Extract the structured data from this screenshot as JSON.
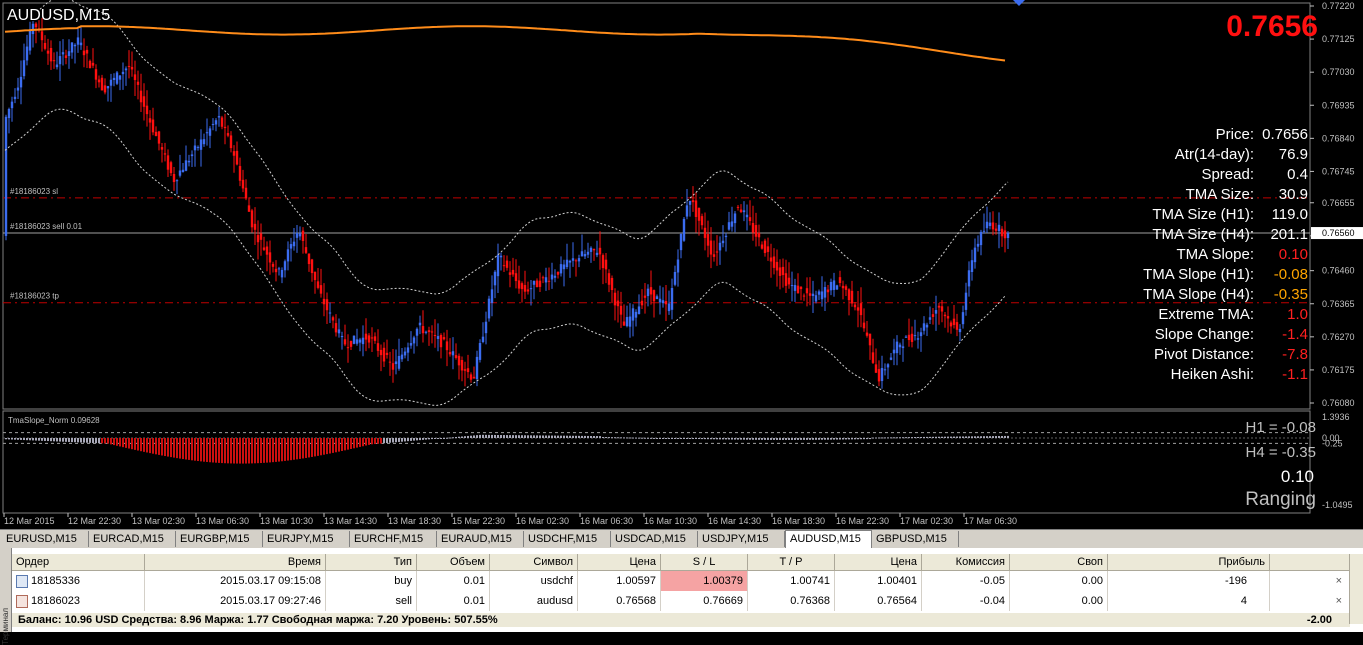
{
  "chart": {
    "symbol_title": "AUDUSD,M15",
    "window_tag": "AUDUSD,M15",
    "big_price": "0.7656",
    "price_scale": [
      "0.77220",
      "0.77125",
      "0.77030",
      "0.76935",
      "0.76840",
      "0.76745",
      "0.76655",
      "0.76560",
      "0.76460",
      "0.76365",
      "0.76270",
      "0.76175",
      "0.76080"
    ],
    "current_price_tag": "0.76560",
    "line_labels": {
      "sl": "#18186023 sl",
      "sell": "#18186023 sell 0.01",
      "tp": "#18186023 tp"
    },
    "info_panel": [
      {
        "label": "Price:",
        "value": "0.7656",
        "color": "#ffffff"
      },
      {
        "label": "Atr(14-day):",
        "value": "76.9",
        "color": "#ffffff"
      },
      {
        "label": "Spread:",
        "value": "0.4",
        "color": "#ffffff"
      },
      {
        "label": "TMA Size:",
        "value": "30.9",
        "color": "#ffffff"
      },
      {
        "label": "TMA Size (H1):",
        "value": "119.0",
        "color": "#ffffff"
      },
      {
        "label": "TMA Size (H4):",
        "value": "201.1",
        "color": "#ffffff"
      },
      {
        "label": "TMA Slope:",
        "value": "0.10",
        "color": "#ff2020"
      },
      {
        "label": "TMA Slope (H1):",
        "value": "-0.08",
        "color": "#ffa500"
      },
      {
        "label": "TMA Slope (H4):",
        "value": "-0.35",
        "color": "#ffa500"
      },
      {
        "label": "Extreme TMA:",
        "value": "1.0",
        "color": "#ff2020"
      },
      {
        "label": "Slope Change:",
        "value": "-1.4",
        "color": "#ff2020"
      },
      {
        "label": "Pivot Distance:",
        "value": "-7.8",
        "color": "#ff2020"
      },
      {
        "label": "Heiken Ashi:",
        "value": "-1.1",
        "color": "#ff2020"
      }
    ],
    "indicator": {
      "title": "TmaSlope_Norm 0.09628",
      "h1_text": "H1 = -0.08",
      "h4_text": "H4 = -0.35",
      "value_text": "0.10",
      "state_text": "Ranging",
      "scale": [
        "1.3936",
        "0.00",
        "-0.25",
        "-1.0495"
      ]
    },
    "time_axis": [
      "12 Mar 2015",
      "12 Mar 22:30",
      "13 Mar 02:30",
      "13 Mar 06:30",
      "13 Mar 10:30",
      "13 Mar 14:30",
      "13 Mar 18:30",
      "15 Mar 22:30",
      "16 Mar 02:30",
      "16 Mar 06:30",
      "16 Mar 10:30",
      "16 Mar 14:30",
      "16 Mar 18:30",
      "16 Mar 22:30",
      "17 Mar 02:30",
      "17 Mar 06:30"
    ],
    "colors": {
      "bull": "#3b6cf0",
      "bear": "#ff1010",
      "tma_long": "#ff8c1a",
      "sl_tp_line": "#c00000",
      "big_price": "#ff1010"
    }
  },
  "tabs": [
    "EURUSD,M15",
    "EURCAD,M15",
    "EURGBP,M15",
    "EURJPY,M15",
    "EURCHF,M15",
    "EURAUD,M15",
    "USDCHF,M15",
    "USDCAD,M15",
    "USDJPY,M15",
    "AUDUSD,M15",
    "GBPUSD,M15"
  ],
  "active_tab": "AUDUSD,M15",
  "terminal": {
    "side_label": "Терминал",
    "headers": [
      "Ордер",
      "Время",
      "Тип",
      "Объем",
      "Символ",
      "Цена",
      "S / L",
      "T / P",
      "Цена",
      "Комиссия",
      "Своп",
      "Прибыль"
    ],
    "rows": [
      {
        "order": "18185336",
        "time": "2015.03.17 09:15:08",
        "type": "buy",
        "volume": "0.01",
        "symbol": "usdchf",
        "price": "1.00597",
        "sl": "1.00379",
        "tp": "1.00741",
        "cur": "1.00401",
        "commission": "-0.05",
        "swap": "0.00",
        "profit": "-196"
      },
      {
        "order": "18186023",
        "time": "2015.03.17 09:27:46",
        "type": "sell",
        "volume": "0.01",
        "symbol": "audusd",
        "price": "0.76568",
        "sl": "0.76669",
        "tp": "0.76368",
        "cur": "0.76564",
        "commission": "-0.04",
        "swap": "0.00",
        "profit": "4"
      }
    ],
    "balance_text": "Баланс: 10.96 USD  Средства: 8.96  Маржа: 1.77  Свободная маржа: 7.20  Уровень: 507.55%",
    "total_profit": "-2.00"
  }
}
